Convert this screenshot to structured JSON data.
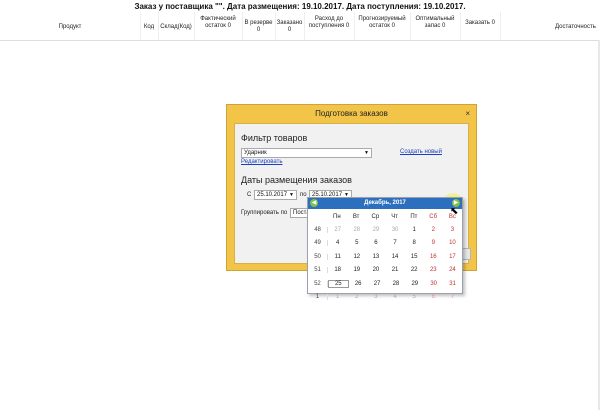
{
  "header": {
    "title": "Заказ у поставщика \"\". Дата размещения: 19.10.2017. Дата поступления: 19.10.2017.",
    "columns": [
      {
        "label": "Продукт"
      },
      {
        "label": "Код"
      },
      {
        "label": "Склад(Код)"
      },
      {
        "label": "Фактический остаток 0"
      },
      {
        "label": "В резерве 0"
      },
      {
        "label": "Заказано 0"
      },
      {
        "label": "Расход до поступления 0"
      },
      {
        "label": "Прогнозируемый остаток 0"
      },
      {
        "label": "Оптимальный запас 0"
      },
      {
        "label": "Заказать 0"
      },
      {
        "label": "Достаточность"
      }
    ]
  },
  "dialog": {
    "title": "Подготовка заказов",
    "close": "×",
    "filter_heading": "Фильтр товаров",
    "filter_value": "Ударник",
    "create_new_link": "Создать новый",
    "edit_link": "Редактировать",
    "dates_heading": "Даты размещения заказов",
    "from_label": "С",
    "from_value": "25.10.2017",
    "to_label": "по",
    "to_value": "25.10.2017",
    "group_label": "Группировать по",
    "group_value": "Поста"
  },
  "calendar": {
    "month": "Декабрь, 2017",
    "prev_icon": "arrow-left-icon",
    "next_icon": "arrow-right-icon",
    "weekdays": [
      "",
      "Пн",
      "Вт",
      "Ср",
      "Чт",
      "Пт",
      "Сб",
      "Вс"
    ],
    "rows": [
      [
        "48",
        "27",
        "28",
        "29",
        "30",
        "1",
        "2",
        "3"
      ],
      [
        "49",
        "4",
        "5",
        "6",
        "7",
        "8",
        "9",
        "10"
      ],
      [
        "50",
        "11",
        "12",
        "13",
        "14",
        "15",
        "16",
        "17"
      ],
      [
        "51",
        "18",
        "19",
        "20",
        "21",
        "22",
        "23",
        "24"
      ],
      [
        "52",
        "25",
        "26",
        "27",
        "28",
        "29",
        "30",
        "31"
      ],
      [
        "1",
        "1",
        "2",
        "3",
        "4",
        "5",
        "6",
        "7"
      ]
    ],
    "today": "25"
  }
}
